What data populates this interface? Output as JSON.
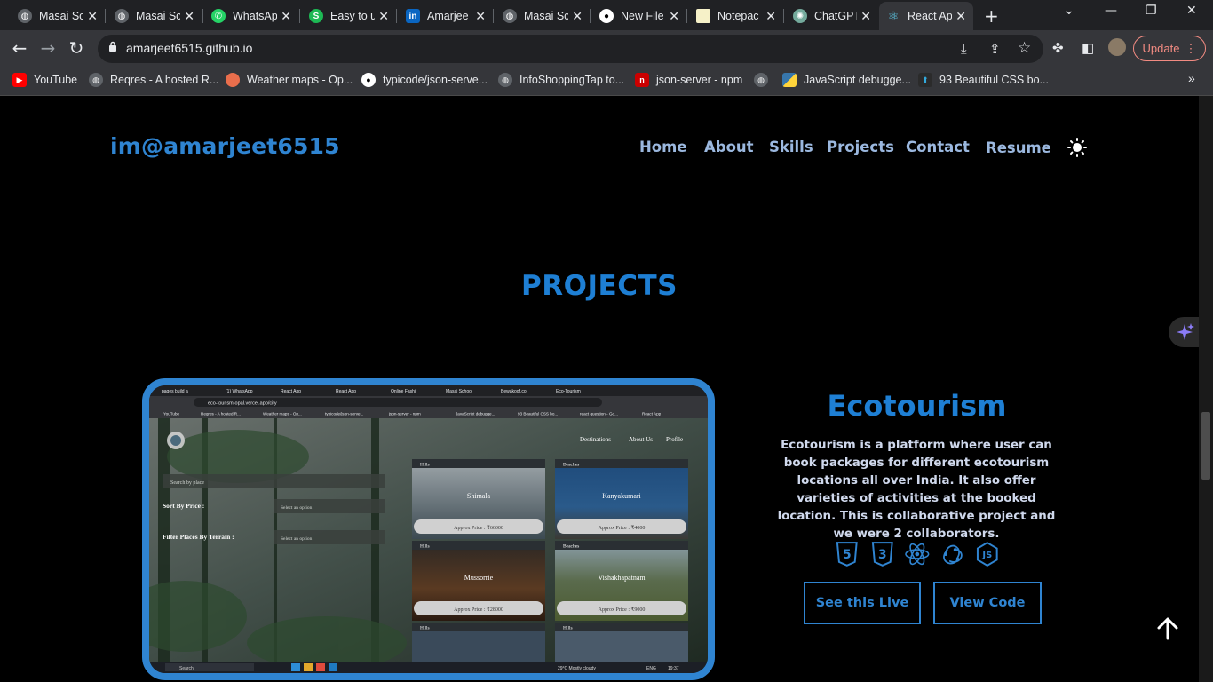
{
  "browser": {
    "tabs": [
      {
        "title": "Masai Sc",
        "icon": "globe-icon",
        "active": false
      },
      {
        "title": "Masai Sc",
        "icon": "globe-icon",
        "active": false
      },
      {
        "title": "WhatsAp",
        "icon": "whatsapp-icon",
        "active": false
      },
      {
        "title": "Easy to u",
        "icon": "s-icon",
        "active": false
      },
      {
        "title": "Amarjee",
        "icon": "linkedin-icon",
        "active": false
      },
      {
        "title": "Masai Sc",
        "icon": "globe-icon",
        "active": false
      },
      {
        "title": "New File",
        "icon": "github-icon",
        "active": false
      },
      {
        "title": "Notepac",
        "icon": "notepad-icon",
        "active": false
      },
      {
        "title": "ChatGPT",
        "icon": "chatgpt-icon",
        "active": false
      },
      {
        "title": "React Ap",
        "icon": "react-icon",
        "active": true
      }
    ],
    "url": "amarjeet6515.github.io",
    "update_label": "Update",
    "bookmarks": [
      {
        "label": "YouTube",
        "icon": "youtube-icon"
      },
      {
        "label": "Reqres - A hosted R...",
        "icon": "globe-icon"
      },
      {
        "label": "Weather maps - Op...",
        "icon": "weather-icon"
      },
      {
        "label": "typicode/json-serve...",
        "icon": "github-icon"
      },
      {
        "label": "InfoShoppingTap to...",
        "icon": "globe-icon"
      },
      {
        "label": "json-server - npm",
        "icon": "npm-icon"
      },
      {
        "label": "JavaScript debugge...",
        "icon": "python-icon"
      },
      {
        "label": "93 Beautiful CSS bo...",
        "icon": "css-icon"
      }
    ]
  },
  "site": {
    "logo": "im@amarjeet6515",
    "nav": [
      "Home",
      "About",
      "Skills",
      "Projects",
      "Contact",
      "Resume"
    ],
    "section_title": "PROJECTS",
    "project": {
      "title": "Ecotourism",
      "description": "Ecotourism is a platform where user can book packages for different ecotourism locations all over India. It also offer varieties of activities at the booked location. This is collaborative project and we were 2 collaborators.",
      "tech_icons": [
        "html5-icon",
        "css3-icon",
        "react-icon",
        "redux-icon",
        "javascript-icon"
      ],
      "live_label": "See this Live",
      "code_label": "View Code"
    },
    "screenshot": {
      "tabs": [
        "pages build a",
        "(1) WhatsApp",
        "React App",
        "React App",
        "Online Fashi",
        "Masai Schoo",
        "Bewakoof.co",
        "Eco-Tourism"
      ],
      "url": "eco-tourism-opal.vercel.app/city",
      "bookmarks": [
        "YouTube",
        "Reqres - A hosted R...",
        "Weather maps - Op...",
        "typicode/json-serve...",
        "json-server - npm",
        "JavaScript debugge...",
        "93 Beautiful CSS bo...",
        "react question - Go...",
        "React App"
      ],
      "nav": [
        "Destinations",
        "About Us",
        "Profile"
      ],
      "search_placeholder": "Search by place",
      "sort_label": "Sort By Price :",
      "filter_label": "Filter Places By Terrain :",
      "select_placeholder": "Select an option",
      "cards": [
        {
          "tag": "Hills",
          "name": "Shimala",
          "price": "Approx Price : ₹66000"
        },
        {
          "tag": "Beaches",
          "name": "Kanyakumari",
          "price": "Approx Price : ₹4000"
        },
        {
          "tag": "Hills",
          "name": "Mussorrie",
          "price": "Approx Price : ₹28000"
        },
        {
          "tag": "Beaches",
          "name": "Vishakhapatnam",
          "price": "Approx Price : ₹9000"
        },
        {
          "tag": "Hills",
          "name": "",
          "price": ""
        },
        {
          "tag": "Hills",
          "name": "",
          "price": ""
        }
      ],
      "taskbar_search": "Search",
      "weather": "29°C  Mostly cloudy",
      "lang": "ENG",
      "time": "19:37"
    }
  },
  "colors": {
    "accent": "#2f84d1",
    "title": "#1e7fd4",
    "nav": "#9bb8df",
    "bg": "#000000"
  }
}
